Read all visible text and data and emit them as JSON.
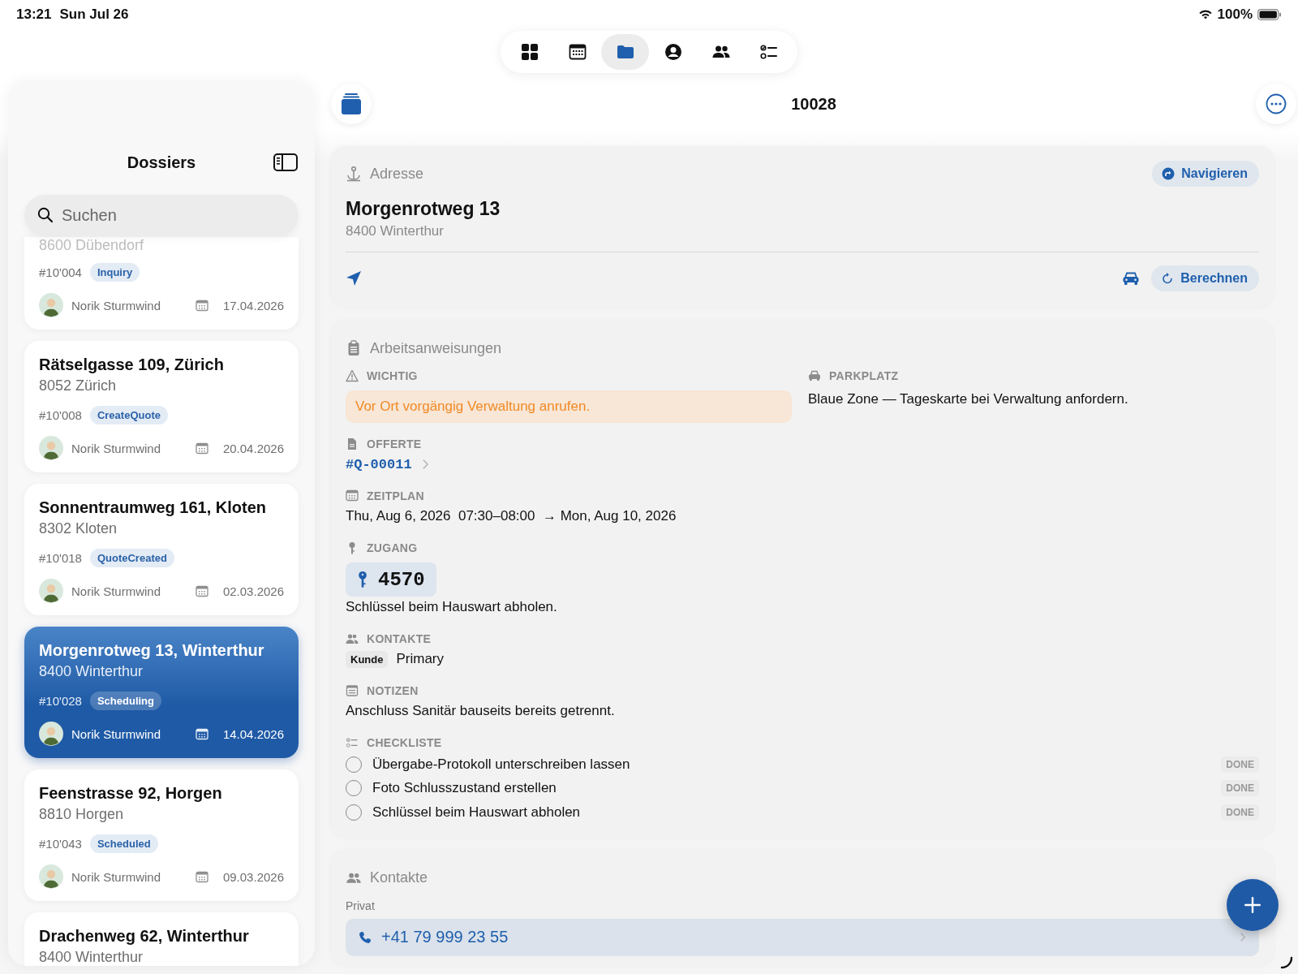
{
  "status_bar": {
    "time": "13:21",
    "date": "Sun Jul 26",
    "battery": "100%"
  },
  "toolbar": {
    "tabs": [
      {
        "kind": "grid",
        "selected": false
      },
      {
        "kind": "calendar",
        "selected": false
      },
      {
        "kind": "folder",
        "selected": true
      },
      {
        "kind": "person",
        "selected": false
      },
      {
        "kind": "people",
        "selected": false
      },
      {
        "kind": "checklist",
        "selected": false
      }
    ]
  },
  "sidebar": {
    "title": "Dossiers",
    "search": {
      "placeholder": "Suchen"
    },
    "items": [
      {
        "city": "8600 Dübendorf",
        "number": "#10'004",
        "status": "Inquiry",
        "assignee": "Norik Sturmwind",
        "date": "17.04.2026",
        "selected": false
      },
      {
        "title": "Rätselgasse 109, Zürich",
        "city": "8052 Zürich",
        "number": "#10'008",
        "status": "CreateQuote",
        "assignee": "Norik Sturmwind",
        "date": "20.04.2026",
        "selected": false
      },
      {
        "title": "Sonnentraumweg 161, Kloten",
        "city": "8302 Kloten",
        "number": "#10'018",
        "status": "QuoteCreated",
        "assignee": "Norik Sturmwind",
        "date": "02.03.2026",
        "selected": false
      },
      {
        "title": "Morgenrotweg 13, Winterthur",
        "city": "8400 Winterthur",
        "number": "#10'028",
        "status": "Scheduling",
        "assignee": "Norik Sturmwind",
        "date": "14.04.2026",
        "selected": true
      },
      {
        "title": "Feenstrasse 92, Horgen",
        "city": "8810 Horgen",
        "number": "#10'043",
        "status": "Scheduled",
        "assignee": "Norik Sturmwind",
        "date": "09.03.2026",
        "selected": false
      },
      {
        "title": "Drachenweg 62, Winterthur",
        "city": "8400 Winterthur",
        "selected": false
      }
    ]
  },
  "detail": {
    "title": "10028",
    "address": {
      "heading": "Adresse",
      "navigate": "Navigieren",
      "street": "Morgenrotweg 13",
      "city": "8400 Winterthur",
      "calculate": "Berechnen"
    },
    "instructions": {
      "heading": "Arbeitsanweisungen",
      "important": {
        "label": "WICHTIG",
        "text": "Vor Ort vorgängig Verwaltung anrufen."
      },
      "parking": {
        "label": "PARKPLATZ",
        "text": "Blaue Zone — Tageskarte bei Verwaltung anfordern."
      },
      "quote": {
        "label": "OFFERTE",
        "link": "#Q-00011"
      },
      "schedule": {
        "label": "ZEITPLAN",
        "text": "Thu, Aug 6, 2026  07:30–08:00  → Mon, Aug 10, 2026"
      },
      "access": {
        "label": "ZUGANG",
        "code": "4570",
        "text": "Schlüssel beim Hauswart abholen."
      },
      "contacts": {
        "label": "KONTAKTE",
        "role": "Kunde",
        "name": "Primary"
      },
      "notes": {
        "label": "NOTIZEN",
        "text": "Anschluss Sanitär bauseits bereits getrennt."
      },
      "checklist": {
        "label": "CHECKLISTE",
        "items": [
          {
            "text": "Übergabe-Protokoll unterschreiben lassen",
            "checked": false,
            "action": "DONE"
          },
          {
            "text": "Foto Schlusszustand erstellen",
            "checked": false,
            "action": "DONE"
          },
          {
            "text": "Schlüssel beim Hauswart abholen",
            "checked": false,
            "action": "DONE"
          }
        ]
      }
    },
    "contacts": {
      "heading": "Kontakte",
      "group": "Privat",
      "phone": "+41 79 999 23 55"
    }
  }
}
